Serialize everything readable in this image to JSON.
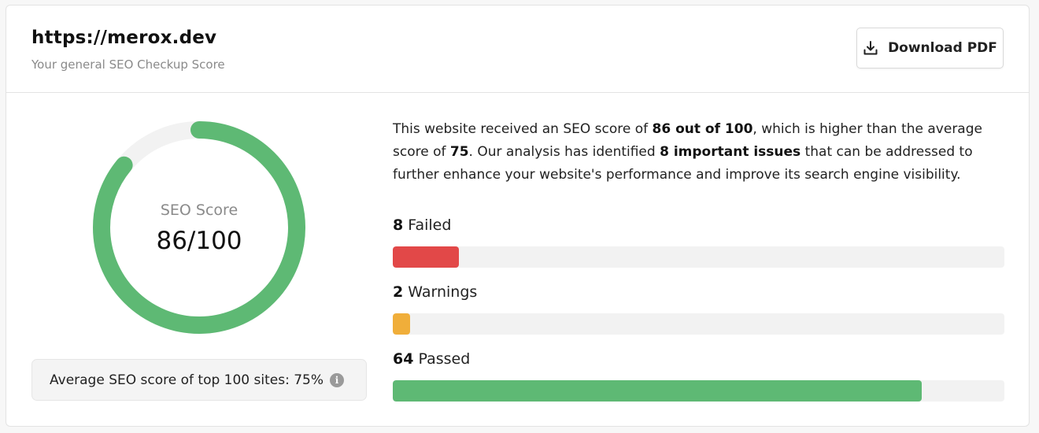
{
  "header": {
    "title": "https://merox.dev",
    "subtitle": "Your general SEO Checkup Score",
    "download_label": "Download PDF",
    "download_icon": "download-icon"
  },
  "score": {
    "label": "SEO Score",
    "value": "86/100",
    "fraction": 0.86,
    "color": "#5eb974",
    "track_color": "#f2f2f2"
  },
  "average": {
    "text": "Average SEO score of top 100 sites: 75%",
    "icon": "info-icon",
    "icon_glyph": "i"
  },
  "description": {
    "part1": "This website received an SEO score of ",
    "bold1": "86 out of 100",
    "part2": ", which is higher than the average score of ",
    "bold2": "75",
    "part3": ". Our analysis has identified ",
    "bold3": "8 important issues",
    "part4": " that can be addressed to further enhance your website's performance and improve its search engine visibility."
  },
  "stats": [
    {
      "count": "8",
      "label": " Failed",
      "fraction": 0.108,
      "color": "#e24848"
    },
    {
      "count": "2",
      "label": " Warnings",
      "fraction": 0.028,
      "color": "#f0ae3a"
    },
    {
      "count": "64",
      "label": " Passed",
      "fraction": 0.865,
      "color": "#5eb974"
    }
  ]
}
